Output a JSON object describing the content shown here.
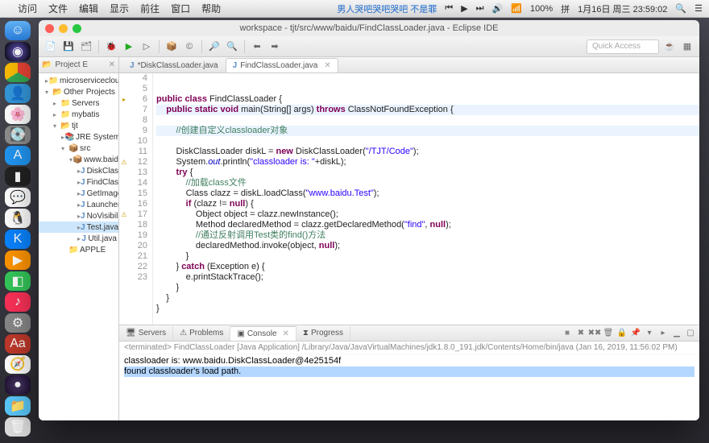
{
  "menubar": {
    "apple": "",
    "items": [
      "访问",
      "文件",
      "编辑",
      "显示",
      "前往",
      "窗口",
      "帮助"
    ],
    "marquee": "男人哭吧哭吧哭吧 不是罪",
    "wifi": "⌃",
    "battery": "100%",
    "time": "1月16日 周三  23:59:02"
  },
  "window": {
    "title": "workspace - tjt/src/www/baidu/FindClassLoader.java - Eclipse IDE",
    "quick_access": "Quick Access"
  },
  "project_pane": {
    "title": "Project E",
    "close": "✕"
  },
  "tree": [
    {
      "ind": 1,
      "tw": "▸",
      "icon": "📁",
      "label": "microservicecloud"
    },
    {
      "ind": 1,
      "tw": "▾",
      "icon": "📂",
      "label": "Other Projects"
    },
    {
      "ind": 2,
      "tw": "▸",
      "icon": "📁",
      "label": "Servers"
    },
    {
      "ind": 2,
      "tw": "▸",
      "icon": "📁",
      "label": "mybatis"
    },
    {
      "ind": 2,
      "tw": "▾",
      "icon": "📂",
      "label": "tjt"
    },
    {
      "ind": 3,
      "tw": "▸",
      "icon": "📚",
      "label": "JRE System Lib"
    },
    {
      "ind": 3,
      "tw": "▾",
      "icon": "📦",
      "label": "src"
    },
    {
      "ind": 4,
      "tw": "▾",
      "icon": "📦",
      "label": "www.baidu"
    },
    {
      "ind": 5,
      "tw": "▸",
      "icon": "J",
      "label": "DiskClass"
    },
    {
      "ind": 5,
      "tw": "▸",
      "icon": "J",
      "label": "FindClass"
    },
    {
      "ind": 5,
      "tw": "▸",
      "icon": "J",
      "label": "GetImage"
    },
    {
      "ind": 5,
      "tw": "▸",
      "icon": "J",
      "label": "Launcher."
    },
    {
      "ind": 5,
      "tw": "▸",
      "icon": "J",
      "label": "NoVisibili"
    },
    {
      "ind": 5,
      "tw": "▸",
      "icon": "J",
      "label": "Test.java",
      "sel": true
    },
    {
      "ind": 5,
      "tw": "▸",
      "icon": "J",
      "label": "Util.java"
    },
    {
      "ind": 3,
      "tw": "",
      "icon": "📁",
      "label": "APPLE"
    }
  ],
  "editor": {
    "tabs": [
      {
        "label": "*DiskClassLoader.java",
        "active": false
      },
      {
        "label": "FindClassLoader.java",
        "active": true
      }
    ],
    "lines": [
      "4",
      "5",
      "6",
      "7",
      "8",
      "9",
      "10",
      "11",
      "12",
      "13",
      "14",
      "15",
      "16",
      "17",
      "18",
      "19",
      "20",
      "21",
      "22",
      "23"
    ],
    "markers": {
      "6": "▸",
      "12": "⚠",
      "17": "⚠"
    }
  },
  "code": {
    "l4": "",
    "l5a": "public class",
    "l5b": " FindClassLoader {",
    "l6a": "    public static void",
    "l6b": " main(String[] args) ",
    "l6c": "throws",
    "l6d": " ClassNotFoundException {",
    "l7": "        //创建自定义classloader对象",
    "l8a": "        DiskClassLoader diskL = ",
    "l8b": "new",
    "l8c": " DiskClassLoader(",
    "l8d": "\"/TJT/Code\"",
    "l8e": ");",
    "l9a": "        System.",
    "l9b": "out",
    "l9c": ".println(",
    "l9d": "\"classloader is: \"",
    "l9e": "+diskL);",
    "l10a": "        try",
    "l10b": " {",
    "l11": "            //加载class文件",
    "l12a": "            Class clazz = diskL.loadClass(",
    "l12b": "\"www.baidu.Test\"",
    "l12c": ");",
    "l13a": "            if",
    "l13b": " (clazz != ",
    "l13c": "null",
    "l13d": ") {",
    "l14": "                Object object = clazz.newInstance();",
    "l15a": "                Method declaredMethod = clazz.getDeclaredMethod(",
    "l15b": "\"find\"",
    "l15c": ", ",
    "l15d": "null",
    "l15e": ");",
    "l16": "                //通过反射调用Test类的find()方法",
    "l17a": "                declaredMethod.invoke(object, ",
    "l17b": "null",
    "l17c": ");",
    "l18": "            }",
    "l19a": "        } ",
    "l19b": "catch",
    "l19c": " (Exception e) {",
    "l20": "            e.printStackTrace();",
    "l21": "        }",
    "l22": "    }",
    "l23": "}"
  },
  "console": {
    "tabs": [
      "Servers",
      "Problems",
      "Console",
      "Progress"
    ],
    "active": 2,
    "header": "<terminated> FindClassLoader [Java Application] /Library/Java/JavaVirtualMachines/jdk1.8.0_191.jdk/Contents/Home/bin/java (Jan 16, 2019, 11:56:02 PM)",
    "line1": "classloader is: www.baidu.DiskClassLoader@4e25154f",
    "line2": "found classloader's load path."
  }
}
